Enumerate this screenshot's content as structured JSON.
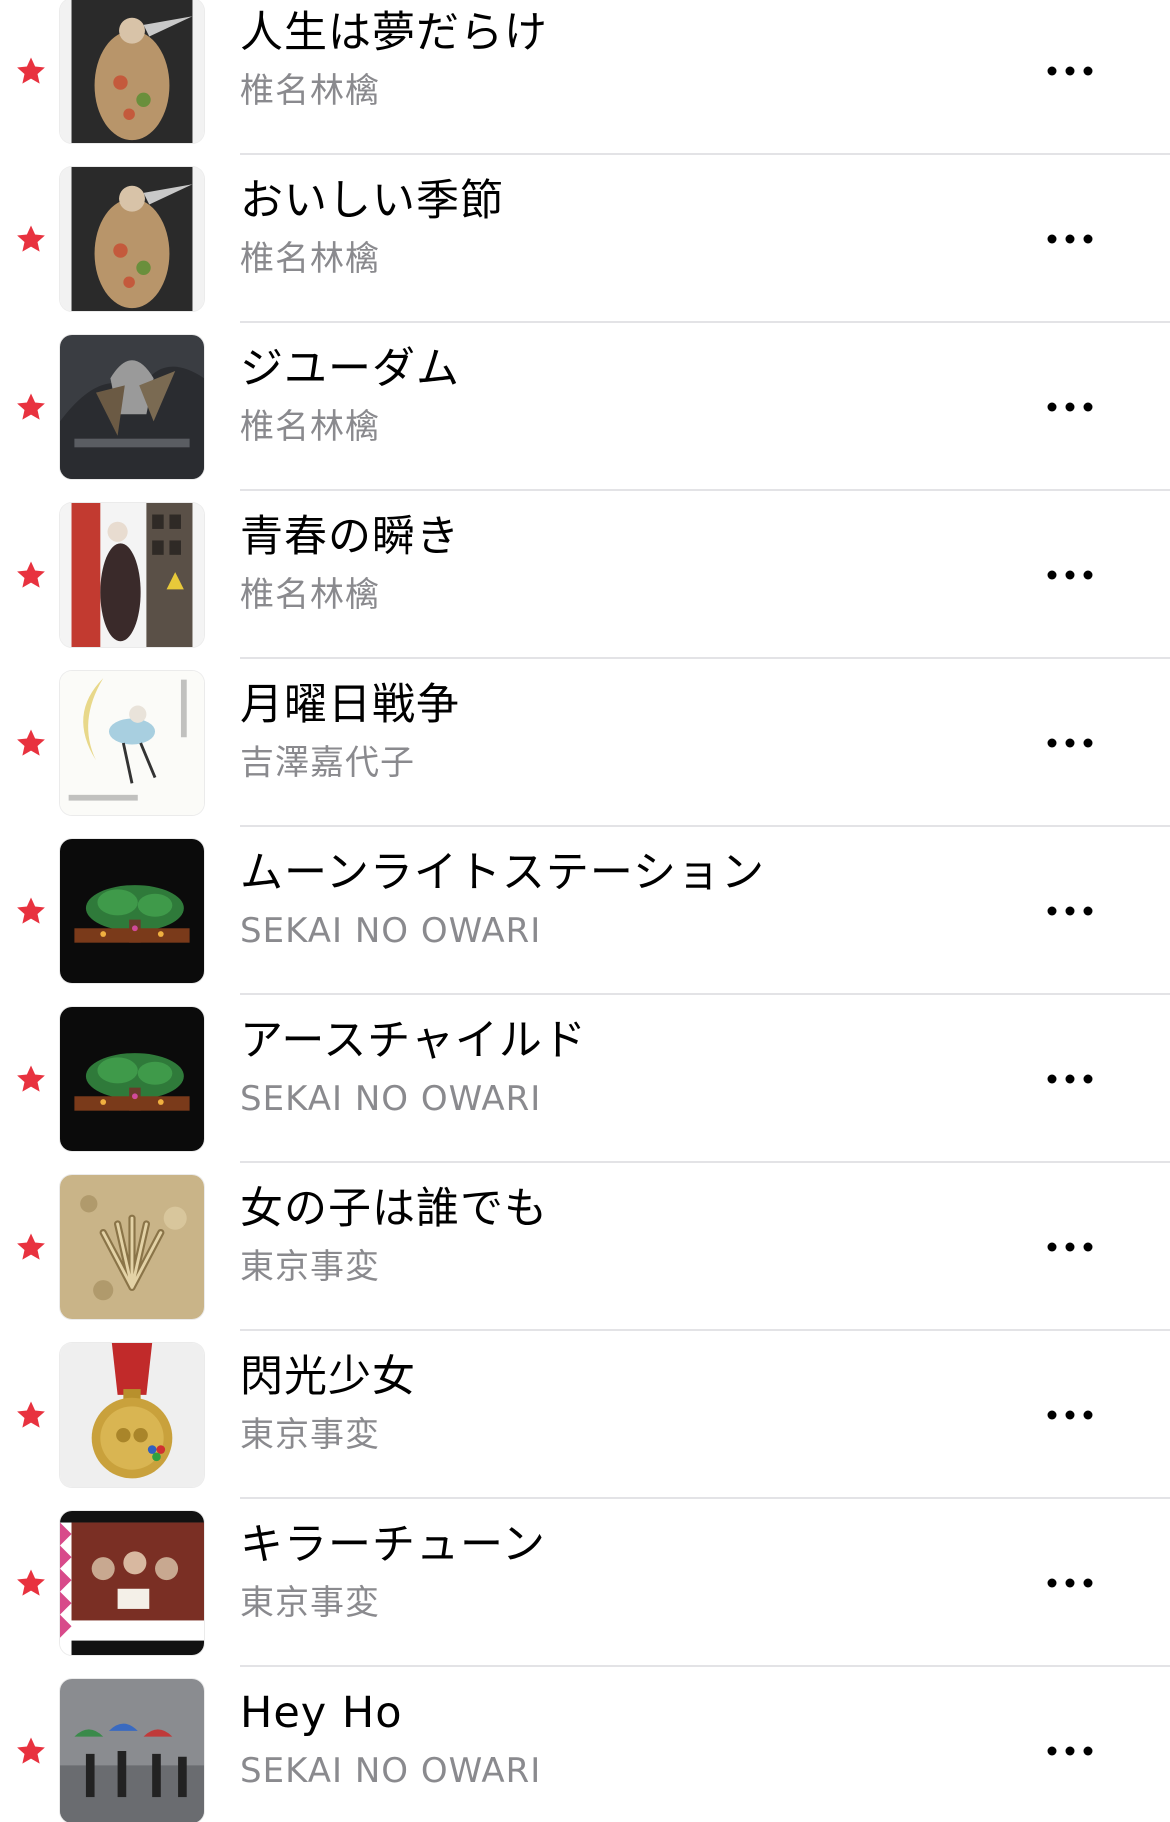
{
  "colors": {
    "star": "#e8323f",
    "title": "#000000",
    "artist": "#8a8a8e",
    "separator": "#e3e3e6"
  },
  "icons": {
    "favorite": "star-icon",
    "more": "more-icon"
  },
  "songs": [
    {
      "title": "人生は夢だらけ",
      "artist": "椎名林檎",
      "favorite": true
    },
    {
      "title": "おいしい季節",
      "artist": "椎名林檎",
      "favorite": true
    },
    {
      "title": "ジユーダム",
      "artist": "椎名林檎",
      "favorite": true
    },
    {
      "title": "青春の瞬き",
      "artist": "椎名林檎",
      "favorite": true
    },
    {
      "title": "月曜日戦争",
      "artist": "吉澤嘉代子",
      "favorite": true
    },
    {
      "title": "ムーンライトステーション",
      "artist": "SEKAI NO OWARI",
      "favorite": true
    },
    {
      "title": "アースチャイルド",
      "artist": "SEKAI NO OWARI",
      "favorite": true
    },
    {
      "title": "女の子は誰でも",
      "artist": "東京事変",
      "favorite": true
    },
    {
      "title": "閃光少女",
      "artist": "東京事変",
      "favorite": true
    },
    {
      "title": "キラーチューン",
      "artist": "東京事変",
      "favorite": true
    },
    {
      "title": "Hey Ho",
      "artist": "SEKAI NO OWARI",
      "favorite": true
    }
  ]
}
